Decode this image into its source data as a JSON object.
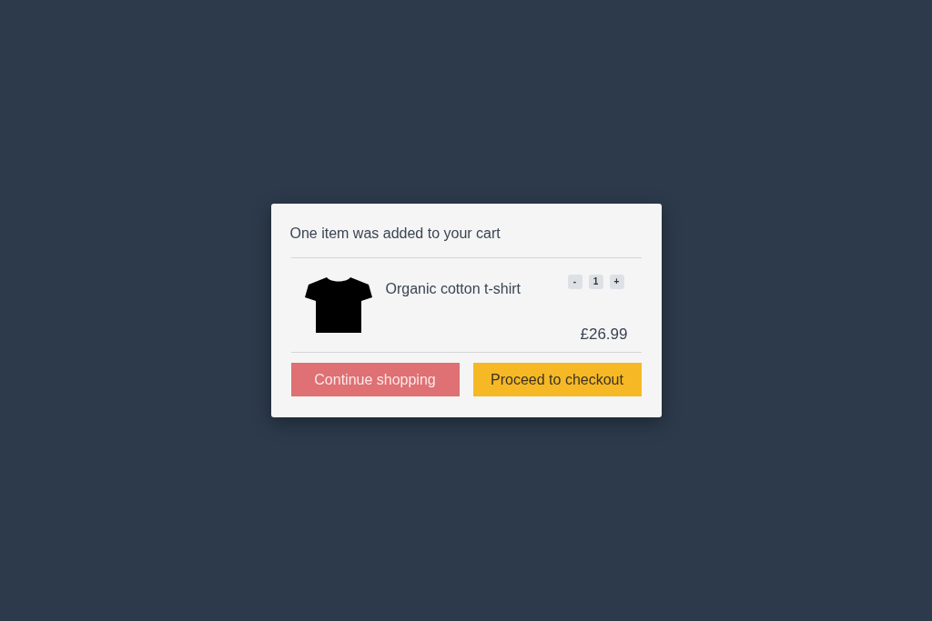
{
  "dialog": {
    "title": "One item was added to your cart",
    "item": {
      "name": "Organic cotton t-shirt",
      "quantity": {
        "decrease": "-",
        "value": "1",
        "increase": "+"
      },
      "price": "£26.99"
    },
    "buttons": [
      {
        "label": "Continue shopping",
        "kind": "secondary"
      },
      {
        "label": "Proceed to checkout",
        "kind": "primary"
      }
    ]
  }
}
